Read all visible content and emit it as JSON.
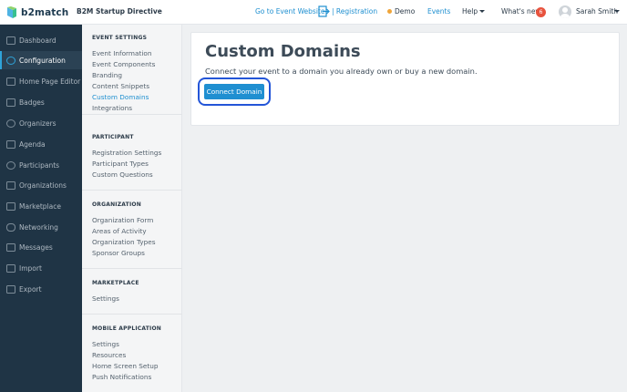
{
  "brand": {
    "name": "b2match"
  },
  "header": {
    "event_title": "B2M Startup Directive",
    "go_to_event": "Go to Event Website",
    "registration": "| Registration",
    "demo": "Demo",
    "events": "Events",
    "help": "Help",
    "whats_new": "What's new",
    "whats_new_count": "6",
    "user_name": "Sarah Smith"
  },
  "sidebar": {
    "items": [
      {
        "label": "Dashboard",
        "icon": "dashboard-icon"
      },
      {
        "label": "Configuration",
        "icon": "wrench-icon",
        "active": true
      },
      {
        "label": "Home Page Editor",
        "icon": "document-icon"
      },
      {
        "label": "Badges",
        "icon": "badge-icon"
      },
      {
        "label": "Organizers",
        "icon": "organizers-icon"
      },
      {
        "label": "Agenda",
        "icon": "calendar-icon"
      },
      {
        "label": "Participants",
        "icon": "participants-icon"
      },
      {
        "label": "Organizations",
        "icon": "building-icon"
      },
      {
        "label": "Marketplace",
        "icon": "list-icon"
      },
      {
        "label": "Networking",
        "icon": "handshake-icon"
      },
      {
        "label": "Messages",
        "icon": "envelope-icon"
      },
      {
        "label": "Import",
        "icon": "import-icon"
      },
      {
        "label": "Export",
        "icon": "export-icon"
      }
    ]
  },
  "submenu": {
    "event_settings": {
      "heading": "EVENT SETTINGS",
      "links": [
        "Event Information",
        "Event Components",
        "Branding",
        "Content Snippets",
        "Custom Domains",
        "Integrations"
      ]
    },
    "participant": {
      "heading": "PARTICIPANT",
      "links": [
        "Registration Settings",
        "Participant Types",
        "Custom Questions"
      ]
    },
    "organization": {
      "heading": "ORGANIZATION",
      "links": [
        "Organization Form",
        "Areas of Activity",
        "Organization Types",
        "Sponsor Groups"
      ]
    },
    "marketplace": {
      "heading": "MARKETPLACE",
      "links": [
        "Settings"
      ]
    },
    "mobile": {
      "heading": "MOBILE APPLICATION",
      "links": [
        "Settings",
        "Resources",
        "Home Screen Setup",
        "Push Notifications"
      ]
    }
  },
  "main": {
    "title": "Custom Domains",
    "description": "Connect your event to a domain you already own or buy a new domain.",
    "connect_button": "Connect Domain"
  },
  "colors": {
    "sidebar_bg": "#1f3445",
    "accent": "#1e8fd0",
    "highlight_outline": "#2355d8",
    "notification": "#e8533e"
  }
}
